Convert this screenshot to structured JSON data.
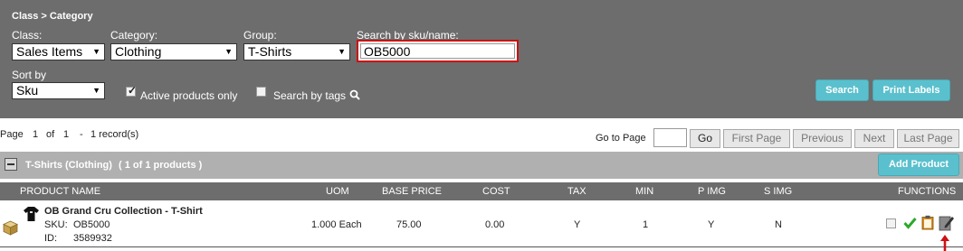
{
  "breadcrumb": "Class > Category",
  "filters": {
    "class_label": "Class:",
    "class_value": "Sales Items",
    "category_label": "Category:",
    "category_value": "Clothing",
    "group_label": "Group:",
    "group_value": "T-Shirts",
    "search_label": "Search by sku/name:",
    "search_value": "OB5000",
    "sort_label": "Sort by",
    "sort_value": "Sku",
    "active_only_label": "Active products only",
    "active_only_checked": true,
    "search_tags_label": "Search by tags",
    "search_tags_checked": false,
    "search_button": "Search",
    "print_labels_button": "Print Labels"
  },
  "pager": {
    "page_word": "Page",
    "page_current": "1",
    "of_word": "of",
    "page_total": "1",
    "dash": "-",
    "records": "1 record(s)",
    "goto_label": "Go to Page",
    "go_button": "Go",
    "first_button": "First Page",
    "previous_button": "Previous",
    "next_button": "Next",
    "last_button": "Last Page"
  },
  "group": {
    "title": "T-Shirts (Clothing)",
    "count_text": "( 1  of  1  products )",
    "add_product_button": "Add Product"
  },
  "table": {
    "headers": {
      "product_name": "PRODUCT NAME",
      "uom": "UOM",
      "base_price": "BASE PRICE",
      "cost": "COST",
      "tax": "TAX",
      "min": "MIN",
      "p_img": "P IMG",
      "s_img": "S IMG",
      "functions": "FUNCTIONS"
    },
    "rows": [
      {
        "name": "OB Grand Cru Collection - T-Shirt",
        "sku_label": "SKU:",
        "sku": "OB5000",
        "id_label": "ID:",
        "id": "3589932",
        "uom": "1.000 Each",
        "base_price": "75.00",
        "cost": "0.00",
        "tax": "Y",
        "min": "1",
        "p_img": "Y",
        "s_img": "N"
      }
    ]
  },
  "colors": {
    "panel": "#6d6d6d",
    "accent": "#5bc0cd",
    "highlight_border": "#cc1111",
    "annotation_arrow": "#cc1111"
  },
  "icons": [
    "box-icon",
    "tshirt-icon",
    "magnifier-icon",
    "checkmark-icon",
    "clipboard-icon",
    "edit-icon",
    "annotation-arrow-icon"
  ]
}
